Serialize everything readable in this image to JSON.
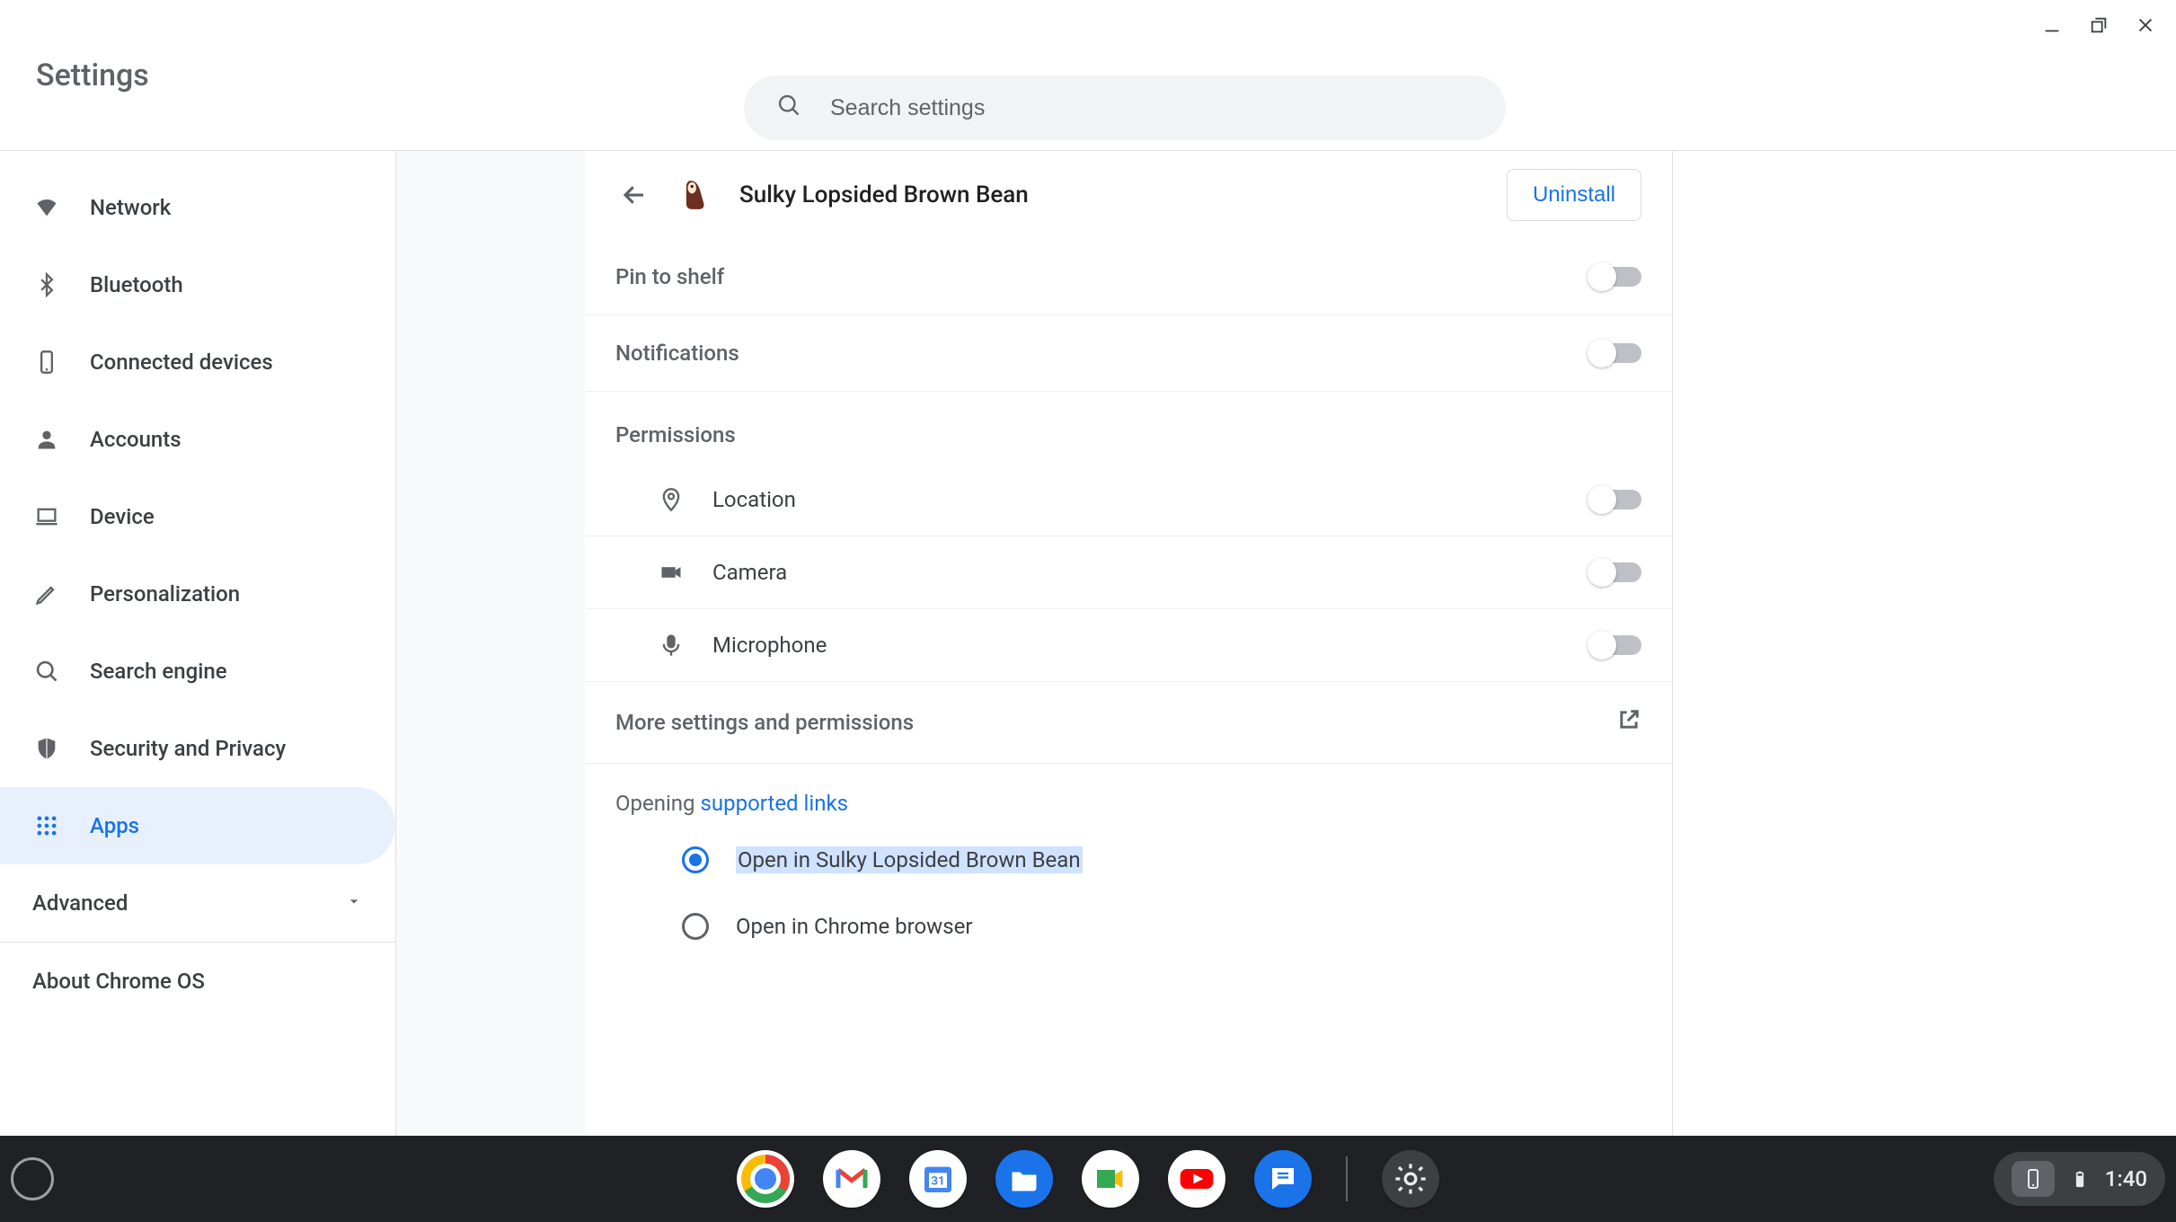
{
  "window": {
    "title": "Settings"
  },
  "search": {
    "placeholder": "Search settings"
  },
  "sidebar": {
    "items": [
      {
        "label": "Network"
      },
      {
        "label": "Bluetooth"
      },
      {
        "label": "Connected devices"
      },
      {
        "label": "Accounts"
      },
      {
        "label": "Device"
      },
      {
        "label": "Personalization"
      },
      {
        "label": "Search engine"
      },
      {
        "label": "Security and Privacy"
      },
      {
        "label": "Apps"
      }
    ],
    "advanced_label": "Advanced",
    "about_label": "About Chrome OS"
  },
  "main": {
    "app_title": "Sulky Lopsided Brown Bean",
    "uninstall_label": "Uninstall",
    "pin_to_shelf_label": "Pin to shelf",
    "notifications_label": "Notifications",
    "permissions_header": "Permissions",
    "permissions": {
      "location": "Location",
      "camera": "Camera",
      "microphone": "Microphone"
    },
    "more_settings_label": "More settings and permissions",
    "opening_prefix": "Opening ",
    "supported_links_label": "supported links",
    "radio_open_app": "Open in Sulky Lopsided Brown Bean",
    "radio_open_browser": "Open in Chrome browser"
  },
  "shelf": {
    "clock": "1:40"
  }
}
